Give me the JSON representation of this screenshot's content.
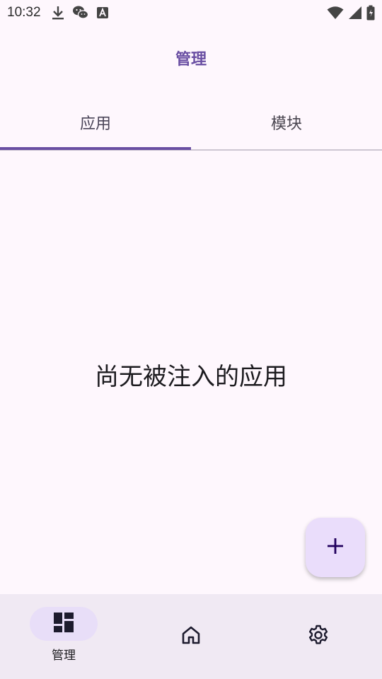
{
  "status_bar": {
    "time": "10:32",
    "left_icons": [
      "download-icon",
      "wechat-icon",
      "text-a-icon"
    ],
    "right_icons": [
      "wifi-icon",
      "signal-icon",
      "battery-icon"
    ]
  },
  "app_bar": {
    "title": "管理"
  },
  "tabs": [
    {
      "label": "应用",
      "selected": true
    },
    {
      "label": "模块",
      "selected": false
    }
  ],
  "content": {
    "empty_message": "尚无被注入的应用"
  },
  "fab": {
    "icon": "plus-icon"
  },
  "bottom_nav": {
    "items": [
      {
        "label": "管理",
        "icon": "dashboard-icon",
        "selected": true
      },
      {
        "label": "",
        "icon": "home-icon",
        "selected": false
      },
      {
        "label": "",
        "icon": "settings-icon",
        "selected": false
      }
    ]
  },
  "colors": {
    "accent": "#6a4fa3",
    "background": "#fef7fd",
    "nav_background": "#f0e9f3",
    "fab_background": "#eaddfb"
  }
}
